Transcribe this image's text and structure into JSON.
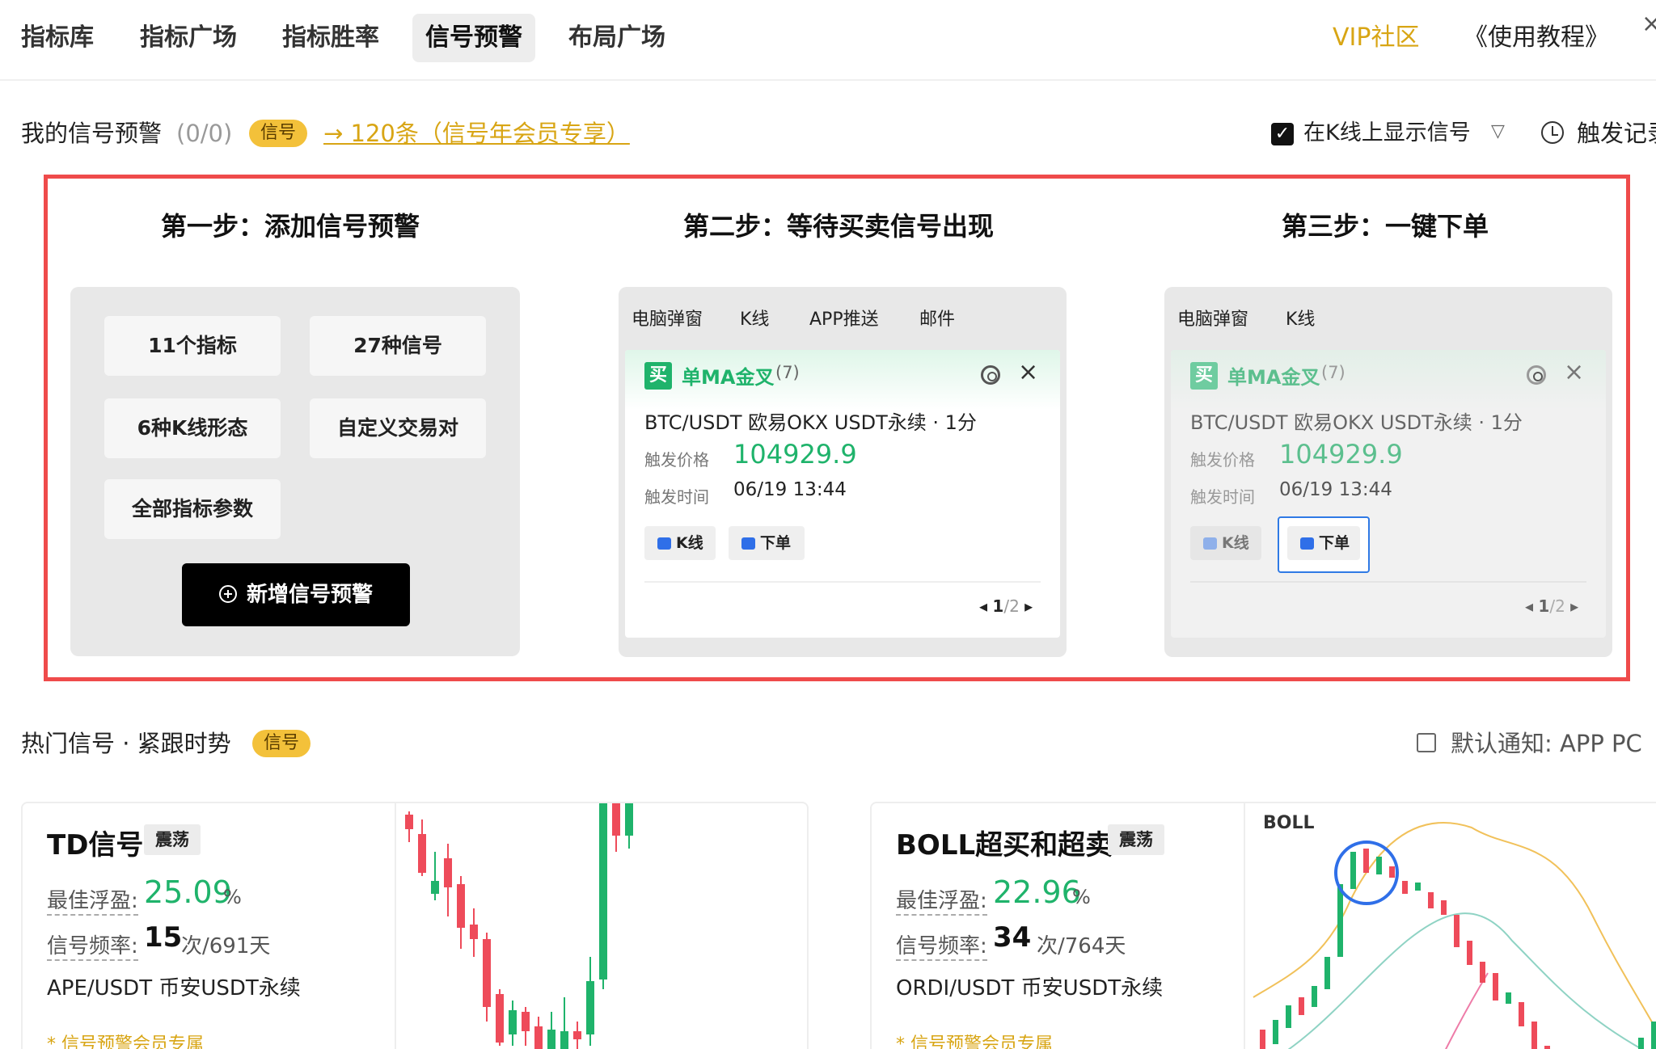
{
  "nav": {
    "tabs": [
      {
        "label": "指标库"
      },
      {
        "label": "指标广场"
      },
      {
        "label": "指标胜率"
      },
      {
        "label": "信号预警"
      },
      {
        "label": "布局广场"
      }
    ],
    "active_tab": "信号预警",
    "vip": "VIP社区",
    "tutorial": "《使用教程》",
    "close": "×"
  },
  "my_signals": {
    "title": "我的信号预警",
    "count": "(0/0)",
    "badge": "信号",
    "quota_link": "→ 120条（信号年会员专享）",
    "show_on_k_label": "在K线上显示信号",
    "show_on_k_checked": true,
    "trigger_records": "触发记录"
  },
  "steps": {
    "step1": {
      "title": "第一步：添加信号预警",
      "chips": [
        "11个指标",
        "27种信号",
        "6种K线形态",
        "自定义交易对",
        "全部指标参数"
      ],
      "add_button": "新增信号预警"
    },
    "step2": {
      "title": "第二步：等待买卖信号出现",
      "tabs": [
        "电脑弹窗",
        "K线",
        "APP推送",
        "邮件"
      ],
      "card": {
        "buy_tag": "买",
        "signal_name": "单MA金叉",
        "signal_count": "(7)",
        "pair": "BTC/USDT 欧易OKX USDT永续 · 1分",
        "price_label": "触发价格",
        "price": "104929.9",
        "time_label": "触发时间",
        "time": "06/19 13:44",
        "kline_btn": "K线",
        "order_btn": "下单",
        "pager_current": "1",
        "pager_total": "/2"
      }
    },
    "step3": {
      "title": "第三步：一键下单",
      "tabs": [
        "电脑弹窗",
        "K线"
      ],
      "card": {
        "buy_tag": "买",
        "signal_name": "单MA金叉",
        "signal_count": "(7)",
        "pair": "BTC/USDT 欧易OKX USDT永续 · 1分",
        "price_label": "触发价格",
        "price": "104929.9",
        "time_label": "触发时间",
        "time": "06/19 13:44",
        "kline_btn": "K线",
        "order_btn": "下单",
        "pager_current": "1",
        "pager_total": "/2"
      }
    }
  },
  "hot": {
    "title": "热门信号 · 紧跟时势",
    "badge": "信号",
    "notify": "默认通知:  APP  PC",
    "cards": [
      {
        "name": "TD信号",
        "tag": "震荡",
        "profit_label": "最佳浮盈:",
        "profit": "25.09",
        "pct": "%",
        "freq_label": "信号频率:",
        "freq": "15",
        "freq_unit": "次/691天",
        "pair": "APE/USDT 币安USDT永续",
        "vip_note": "* 信号预警会员专属"
      },
      {
        "name": "BOLL超买和超卖",
        "tag": "震荡",
        "profit_label": "最佳浮盈:",
        "profit": "22.96",
        "pct": "%",
        "freq_label": "信号频率:",
        "freq": "34",
        "freq_unit": "次/764天",
        "pair": "ORDI/USDT 币安USDT永续",
        "vip_note": "* 信号预警会员专属",
        "chart_label": "BOLL"
      }
    ]
  },
  "colors": {
    "accent_gold": "#d8a514",
    "green": "#1fb36b",
    "red": "#ee4b5a",
    "frame_red": "#ef4b4b",
    "highlight_blue": "#2f7ae5"
  }
}
